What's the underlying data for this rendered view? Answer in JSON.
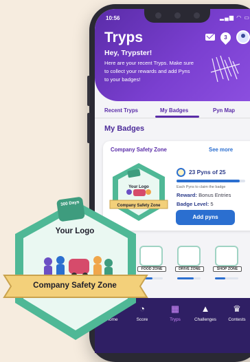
{
  "status": {
    "time": "10:56",
    "icons": "▂▄▆ ◠ ▭"
  },
  "header": {
    "title": "Tryps",
    "notification_count": "3",
    "greeting": "Hey, Trypster!",
    "intro": "Here are your recent Tryps. Make sure to collect your rewards and add Pyns to your badges!"
  },
  "tabs": [
    {
      "label": "Recent Tryps"
    },
    {
      "label": "My Badges",
      "active": true
    },
    {
      "label": "Pyn Map"
    }
  ],
  "section_title": "My Badges",
  "badge_card": {
    "title": "Company Safety Zone",
    "see_more": "See more",
    "badge_logo": "Your Logo",
    "badge_name": "Company Safety Zone",
    "pyns": "23 Pyns of  25",
    "progress": 0.92,
    "claim_note": "Each Pyns to claim the badge",
    "reward_label": "Reward:",
    "reward_value": "Bonus Entries",
    "level_label": "Badge Level:",
    "level_value": "5",
    "add_button": "Add pyns"
  },
  "zones": [
    {
      "label": "FOOD ZONE",
      "progress": 0.55
    },
    {
      "label": "DRIVE ZONE",
      "progress": 0.7
    },
    {
      "label": "SHOP ZONE",
      "progress": 0.45
    }
  ],
  "nav": [
    {
      "label": "Home",
      "icon": "home-icon",
      "glyph": "⌂"
    },
    {
      "label": "Score",
      "icon": "gauge-icon",
      "glyph": "◔"
    },
    {
      "label": "Tryps",
      "icon": "map-icon",
      "glyph": "▦",
      "active": true
    },
    {
      "label": "Challenges",
      "icon": "mountain-icon",
      "glyph": "▲"
    },
    {
      "label": "Contests",
      "icon": "trophy-icon",
      "glyph": "♛"
    }
  ],
  "big_badge": {
    "days": "300 Days",
    "logo": "Your Logo",
    "name": "Company Safety Zone"
  },
  "colors": {
    "brand": "#5a2ca8",
    "accent": "#2b6fd0",
    "badge_green": "#4fb896",
    "ribbon": "#f3d07a"
  }
}
